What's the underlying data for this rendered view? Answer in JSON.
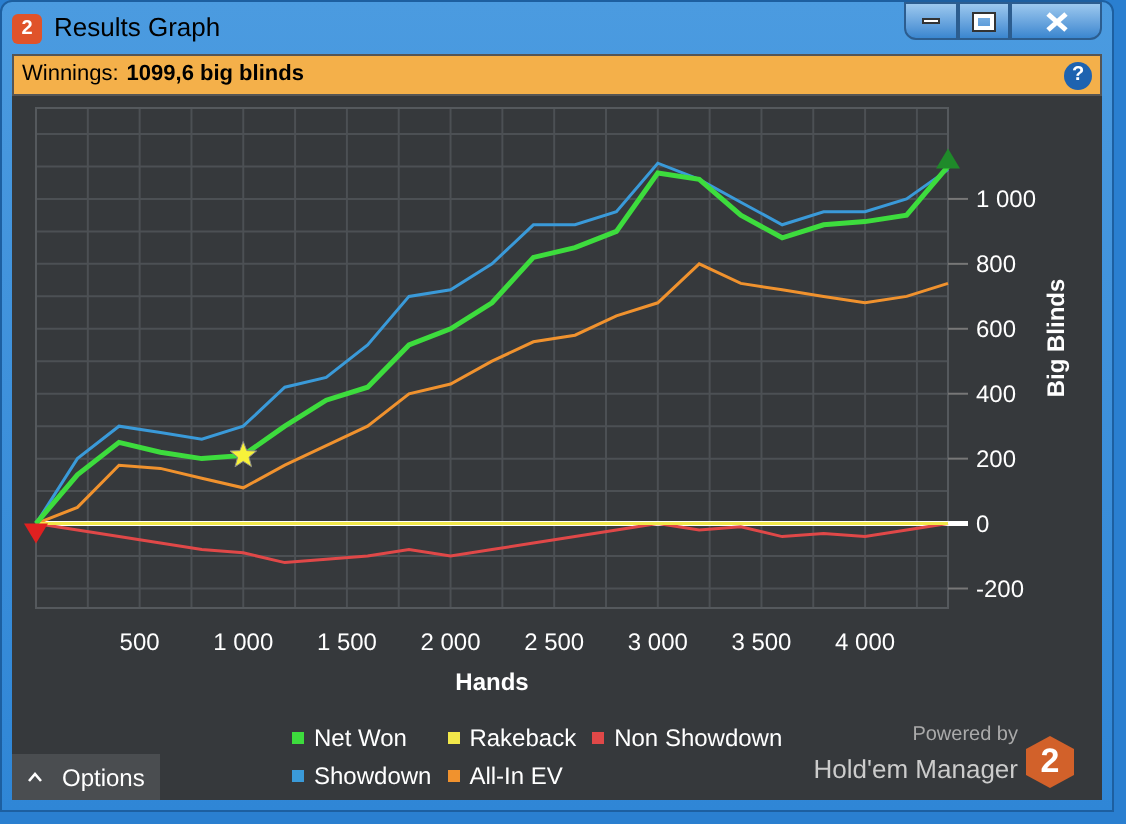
{
  "window": {
    "logo": "2",
    "title": "Results Graph"
  },
  "help_button": {
    "label": "?"
  },
  "winnings": {
    "label": "Winnings:",
    "value": "1099,6 big blinds"
  },
  "chart": {
    "chart_data": {
      "type": "line",
      "xlabel": "Hands",
      "ylabel": "Big Blinds",
      "x": [
        0,
        200,
        400,
        600,
        800,
        1000,
        1200,
        1400,
        1600,
        1800,
        2000,
        2200,
        2400,
        2600,
        2800,
        3000,
        3200,
        3400,
        3600,
        3800,
        4000,
        4200,
        4400
      ],
      "series": [
        {
          "name": "Net Won",
          "color": "#3ddc3d",
          "values": [
            0,
            150,
            250,
            220,
            200,
            210,
            300,
            380,
            420,
            550,
            600,
            680,
            820,
            850,
            900,
            1080,
            1060,
            950,
            880,
            920,
            930,
            950,
            1100
          ]
        },
        {
          "name": "Rakeback",
          "color": "#f2e84a",
          "values": [
            0,
            0,
            0,
            0,
            0,
            0,
            0,
            0,
            0,
            0,
            0,
            0,
            0,
            0,
            0,
            0,
            0,
            0,
            0,
            0,
            0,
            0,
            0
          ]
        },
        {
          "name": "Non Showdown",
          "color": "#e04848",
          "values": [
            0,
            -20,
            -40,
            -60,
            -80,
            -90,
            -120,
            -110,
            -100,
            -80,
            -100,
            -80,
            -60,
            -40,
            -20,
            0,
            -20,
            -10,
            -40,
            -30,
            -40,
            -20,
            0
          ]
        },
        {
          "name": "Showdown",
          "color": "#3a9ad9",
          "values": [
            0,
            200,
            300,
            280,
            260,
            300,
            420,
            450,
            550,
            700,
            720,
            800,
            920,
            920,
            960,
            1110,
            1060,
            990,
            920,
            960,
            960,
            1000,
            1090
          ]
        },
        {
          "name": "All-In EV",
          "color": "#f0922e",
          "values": [
            0,
            50,
            180,
            170,
            140,
            110,
            180,
            240,
            300,
            400,
            430,
            500,
            560,
            580,
            640,
            680,
            800,
            740,
            720,
            700,
            680,
            700,
            740
          ]
        }
      ],
      "grid": true,
      "xlim": [
        0,
        4400
      ],
      "ylim": [
        -260,
        1280
      ],
      "xticks": [
        {
          "value": 500,
          "label": "500"
        },
        {
          "value": 1000,
          "label": "1 000"
        },
        {
          "value": 1500,
          "label": "1 500"
        },
        {
          "value": 2000,
          "label": "2 000"
        },
        {
          "value": 2500,
          "label": "2 500"
        },
        {
          "value": 3000,
          "label": "3 000"
        },
        {
          "value": 3500,
          "label": "3 500"
        },
        {
          "value": 4000,
          "label": "4 000"
        }
      ],
      "yticks": [
        {
          "value": -200,
          "label": "-200"
        },
        {
          "value": 0,
          "label": "0"
        },
        {
          "value": 200,
          "label": "200"
        },
        {
          "value": 400,
          "label": "400"
        },
        {
          "value": 600,
          "label": "600"
        },
        {
          "value": 800,
          "label": "800"
        },
        {
          "value": 1000,
          "label": "1 000"
        }
      ]
    }
  },
  "options_button": {
    "label": "Options"
  },
  "branding": {
    "powered_by": "Powered by",
    "product": "Hold'em Manager",
    "logo": "2"
  }
}
